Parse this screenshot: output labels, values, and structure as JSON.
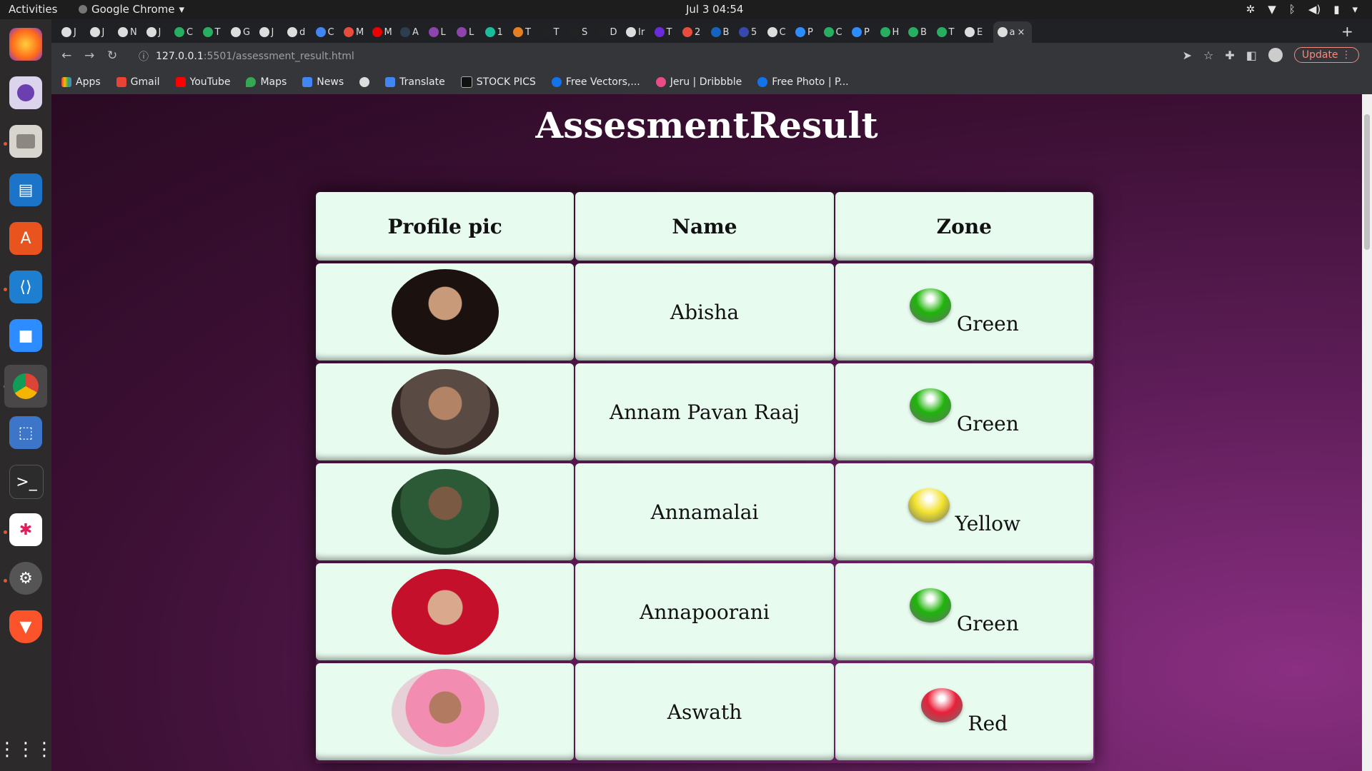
{
  "topbar": {
    "activities": "Activities",
    "app_name": "Google Chrome",
    "clock": "Jul 3  04:54"
  },
  "browser": {
    "url_host": "127.0.0.1",
    "url_path": ":5501/assessment_result.html",
    "update_label": "Update",
    "tabs": [
      "J",
      "J",
      "N",
      "J",
      "C",
      "T",
      "G",
      "J",
      "d",
      "C",
      "M",
      "M",
      "A",
      "L",
      "L",
      "1",
      "T",
      "T",
      "S",
      "D",
      "Ir",
      "T",
      "2",
      "B",
      "5",
      "C",
      "P",
      "C",
      "P",
      "H",
      "B",
      "T",
      "E",
      "a"
    ],
    "bookmarks": [
      "Apps",
      "Gmail",
      "YouTube",
      "Maps",
      "News",
      "",
      "Translate",
      "STOCK PICS",
      "Free Vectors,...",
      "Jeru | Dribbble",
      "Free Photo | P..."
    ]
  },
  "page": {
    "title": "AssesmentResult",
    "headers": {
      "pic": "Profile pic",
      "name": "Name",
      "zone": "Zone"
    },
    "rows": [
      {
        "name": "Abisha",
        "zone": "Green",
        "zone_color": "#1fb40a"
      },
      {
        "name": "Annam Pavan Raaj",
        "zone": "Green",
        "zone_color": "#1fb40a"
      },
      {
        "name": "Annamalai",
        "zone": "Yellow",
        "zone_color": "#f2e22d"
      },
      {
        "name": "Annapoorani",
        "zone": "Green",
        "zone_color": "#1fb40a"
      },
      {
        "name": "Aswath",
        "zone": "Red",
        "zone_color": "#e8203a"
      }
    ]
  }
}
